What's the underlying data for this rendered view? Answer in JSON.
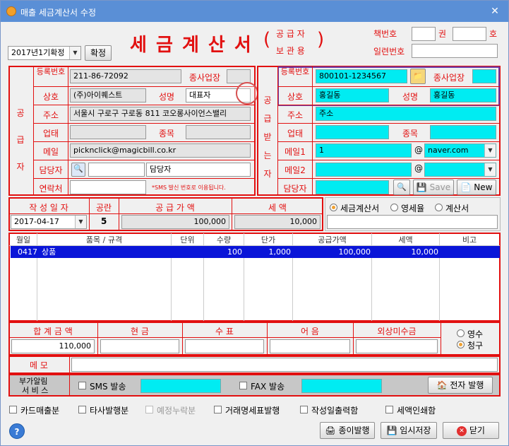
{
  "window": {
    "title": "매출 세금계산서 수정",
    "close": "✕"
  },
  "heading": {
    "main": "세 금 계 산 서",
    "paren_open": "(",
    "paren_close": ")",
    "line1": "공 급 자",
    "line2": "보 관 용"
  },
  "book": {
    "vol_label": "책번호",
    "kwon": "권",
    "ho": "호",
    "serial_label": "일련번호",
    "vol_value": "",
    "ho_value": "",
    "serial_value": ""
  },
  "period": {
    "value": "2017년1기확정",
    "confirm_label": "확정"
  },
  "supplier": {
    "side_label": "공 급 자",
    "reg_label": "등록번호",
    "reg_value": "211-86-72092",
    "branch_label": "종사업장",
    "branch_value": "",
    "name_label": "상호",
    "name_value": "(주)아이퀘스트",
    "rep_label": "성명",
    "rep_value": "대표자",
    "addr_label": "주소",
    "addr_value": "서울시 구로구 구로동 811 코오롱사이언스밸리",
    "biz_label": "업태",
    "biz_value": "",
    "item_label": "종목",
    "item_value": "",
    "mail_label": "메일",
    "mail_value": "picknclick@magicbill.co.kr",
    "manager_label": "담당자",
    "manager_value": "",
    "manager_name": "담당자",
    "contact_label": "연락처",
    "contact_value": "",
    "sms_notice": "*SMS 발신 번호로 이용됩니다."
  },
  "receiver": {
    "side_label": "공 급 받 는 자",
    "reg_label": "등록번호",
    "reg_value": "800101-1234567",
    "branch_label": "종사업장",
    "branch_value": "",
    "name_label": "상호",
    "name_value": "홍길동",
    "rep_label": "성명",
    "rep_value": "홍길동",
    "addr_label": "주소",
    "addr_value": "주소",
    "biz_label": "업태",
    "biz_value": "",
    "item_label": "종목",
    "item_value": "",
    "mail1_label": "메일1",
    "mail1_user": "1",
    "at": "@",
    "mail1_domain": "naver.com",
    "mail2_label": "메일2",
    "mail2_user": "",
    "mail2_domain": "",
    "manager_label": "담당자",
    "manager_value": "",
    "save_label": "Save",
    "new_label": "New"
  },
  "summary": {
    "date_label": "작 성 일 자",
    "date_value": "2017-04-17",
    "blank_label": "공란",
    "blank_value": "5",
    "supply_label": "공 급 가 액",
    "supply_value": "100,000",
    "tax_label": "세 액",
    "tax_value": "10,000",
    "types": [
      "세금계산서",
      "영세율",
      "계산서"
    ],
    "type_selected": "세금계산서"
  },
  "grid": {
    "headers": [
      "월일",
      "품목 / 규격",
      "단위",
      "수량",
      "단가",
      "공급가액",
      "세액",
      "비고"
    ],
    "rows": [
      {
        "date": "0417",
        "item": "상품",
        "unit": "",
        "qty": "100",
        "price": "1,000",
        "supply": "100,000",
        "tax": "10,000",
        "note": ""
      }
    ]
  },
  "totals": {
    "total_label": "합 계 금 액",
    "cash_label": "현 금",
    "check_label": "수 표",
    "note_label": "어 음",
    "credit_label": "외상미수금",
    "total_value": "110,000",
    "cash_value": "",
    "check_value": "",
    "note_value": "",
    "credit_value": "",
    "receipt_label": "영수",
    "claim_label": "청구",
    "selected": "청구"
  },
  "memo": {
    "label": "메 모",
    "value": ""
  },
  "addon": {
    "label1": "부가알림",
    "label2": "서 비 스",
    "sms_label": "SMS 발송",
    "fax_label": "FAX 발송",
    "e_issue_label": "전자 발행"
  },
  "options": [
    "카드매출분",
    "타사발행분",
    "예정누락분",
    "거래명세표발행",
    "작성일출력함",
    "세액인쇄함"
  ],
  "footer": {
    "help": "?",
    "print_label": "종이발행",
    "save_label": "임시저장",
    "close_label": "닫기"
  },
  "colors": {
    "accent_red": "#e21010",
    "cyan_field": "#00ecf2",
    "title_bar": "#5a8fd6",
    "selected_row": "#0a15d8",
    "purple_box": "#6a3aa8"
  }
}
